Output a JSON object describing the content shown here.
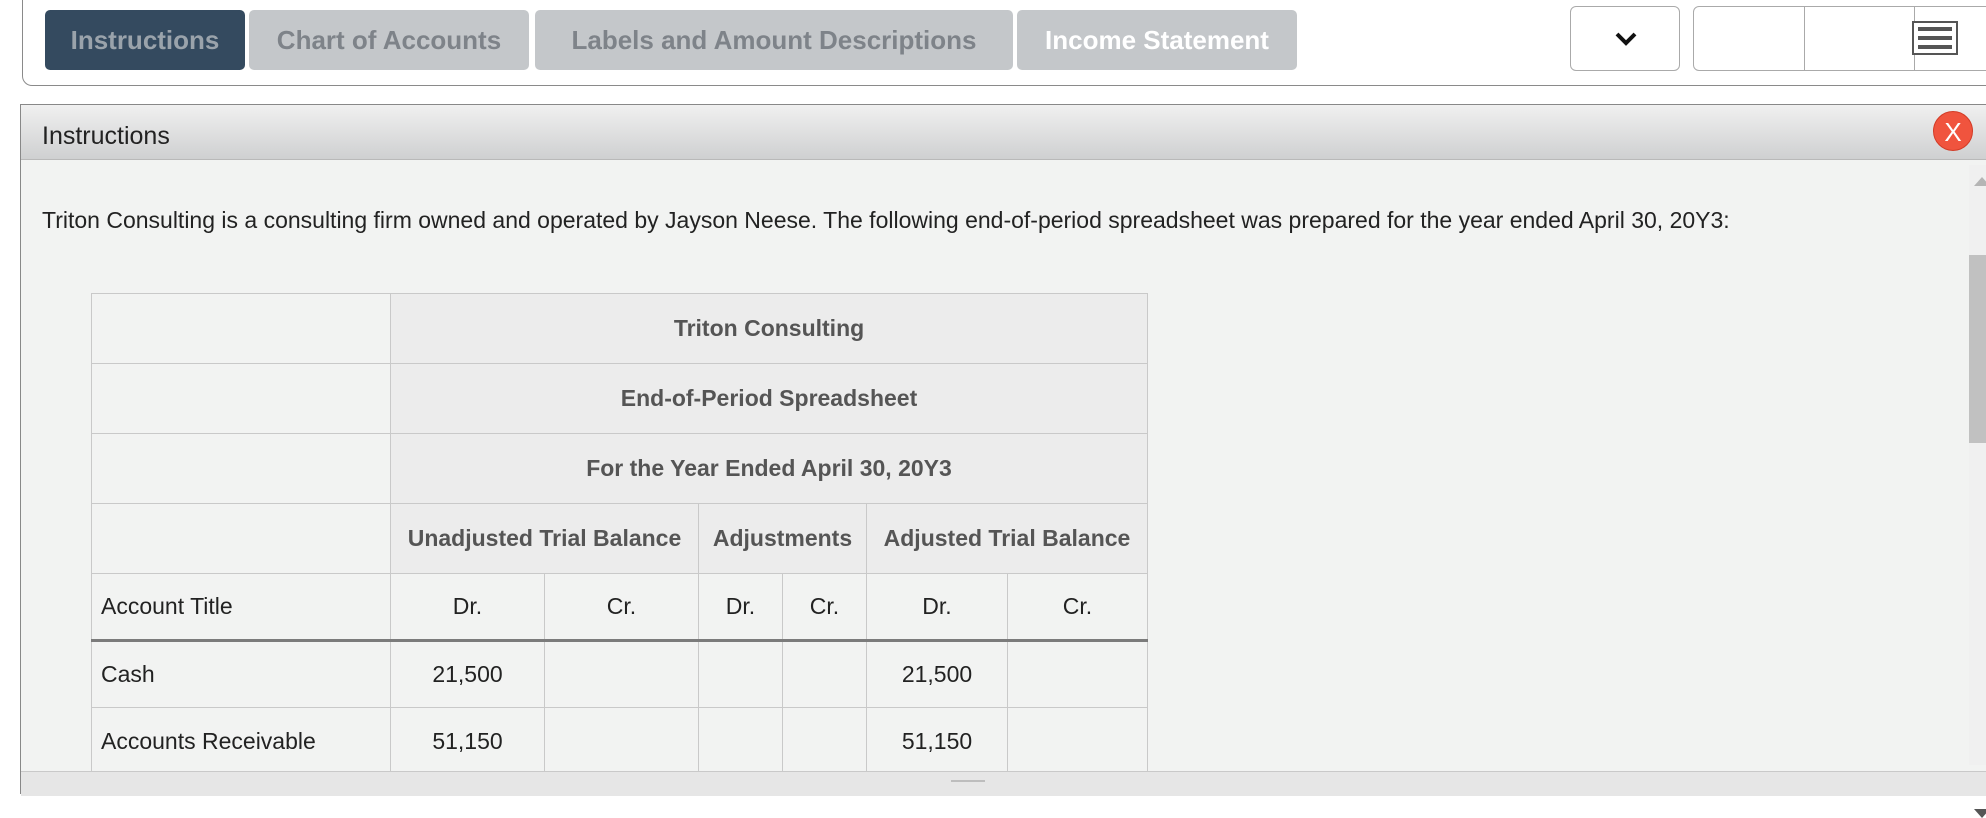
{
  "tabs": {
    "instructions": "Instructions",
    "chart_of_accounts": "Chart of Accounts",
    "labels": "Labels and Amount Descriptions",
    "income_statement": "Income Statement"
  },
  "panel": {
    "title": "Instructions",
    "close_label": "X",
    "intro": "Triton Consulting is a consulting firm owned and operated by Jayson Neese. The following end-of-period spreadsheet was prepared for the year ended April 30, 20Y3:"
  },
  "sheet": {
    "company": "Triton Consulting",
    "title": "End-of-Period Spreadsheet",
    "period": "For the Year Ended April 30, 20Y3",
    "groups": [
      "Unadjusted Trial Balance",
      "Adjustments",
      "Adjusted Trial Balance"
    ],
    "account_title": "Account Title",
    "dr": "Dr.",
    "cr": "Cr.",
    "rows": [
      {
        "account": "Cash",
        "unadj_dr": "21,500",
        "unadj_cr": "",
        "adj_dr": "",
        "adj_cr": "",
        "adjtb_dr": "21,500",
        "adjtb_cr": ""
      },
      {
        "account": "Accounts Receivable",
        "unadj_dr": "51,150",
        "unadj_cr": "",
        "adj_dr": "",
        "adj_cr": "",
        "adjtb_dr": "51,150",
        "adjtb_cr": ""
      }
    ]
  },
  "icons": {
    "dropdown": "chevron-down-icon",
    "menu": "hamburger-menu-icon",
    "close": "close-icon"
  },
  "colors": {
    "active_tab": "#344a5f",
    "inactive_tab": "#c4c7ca",
    "close_button": "#f0543e"
  }
}
